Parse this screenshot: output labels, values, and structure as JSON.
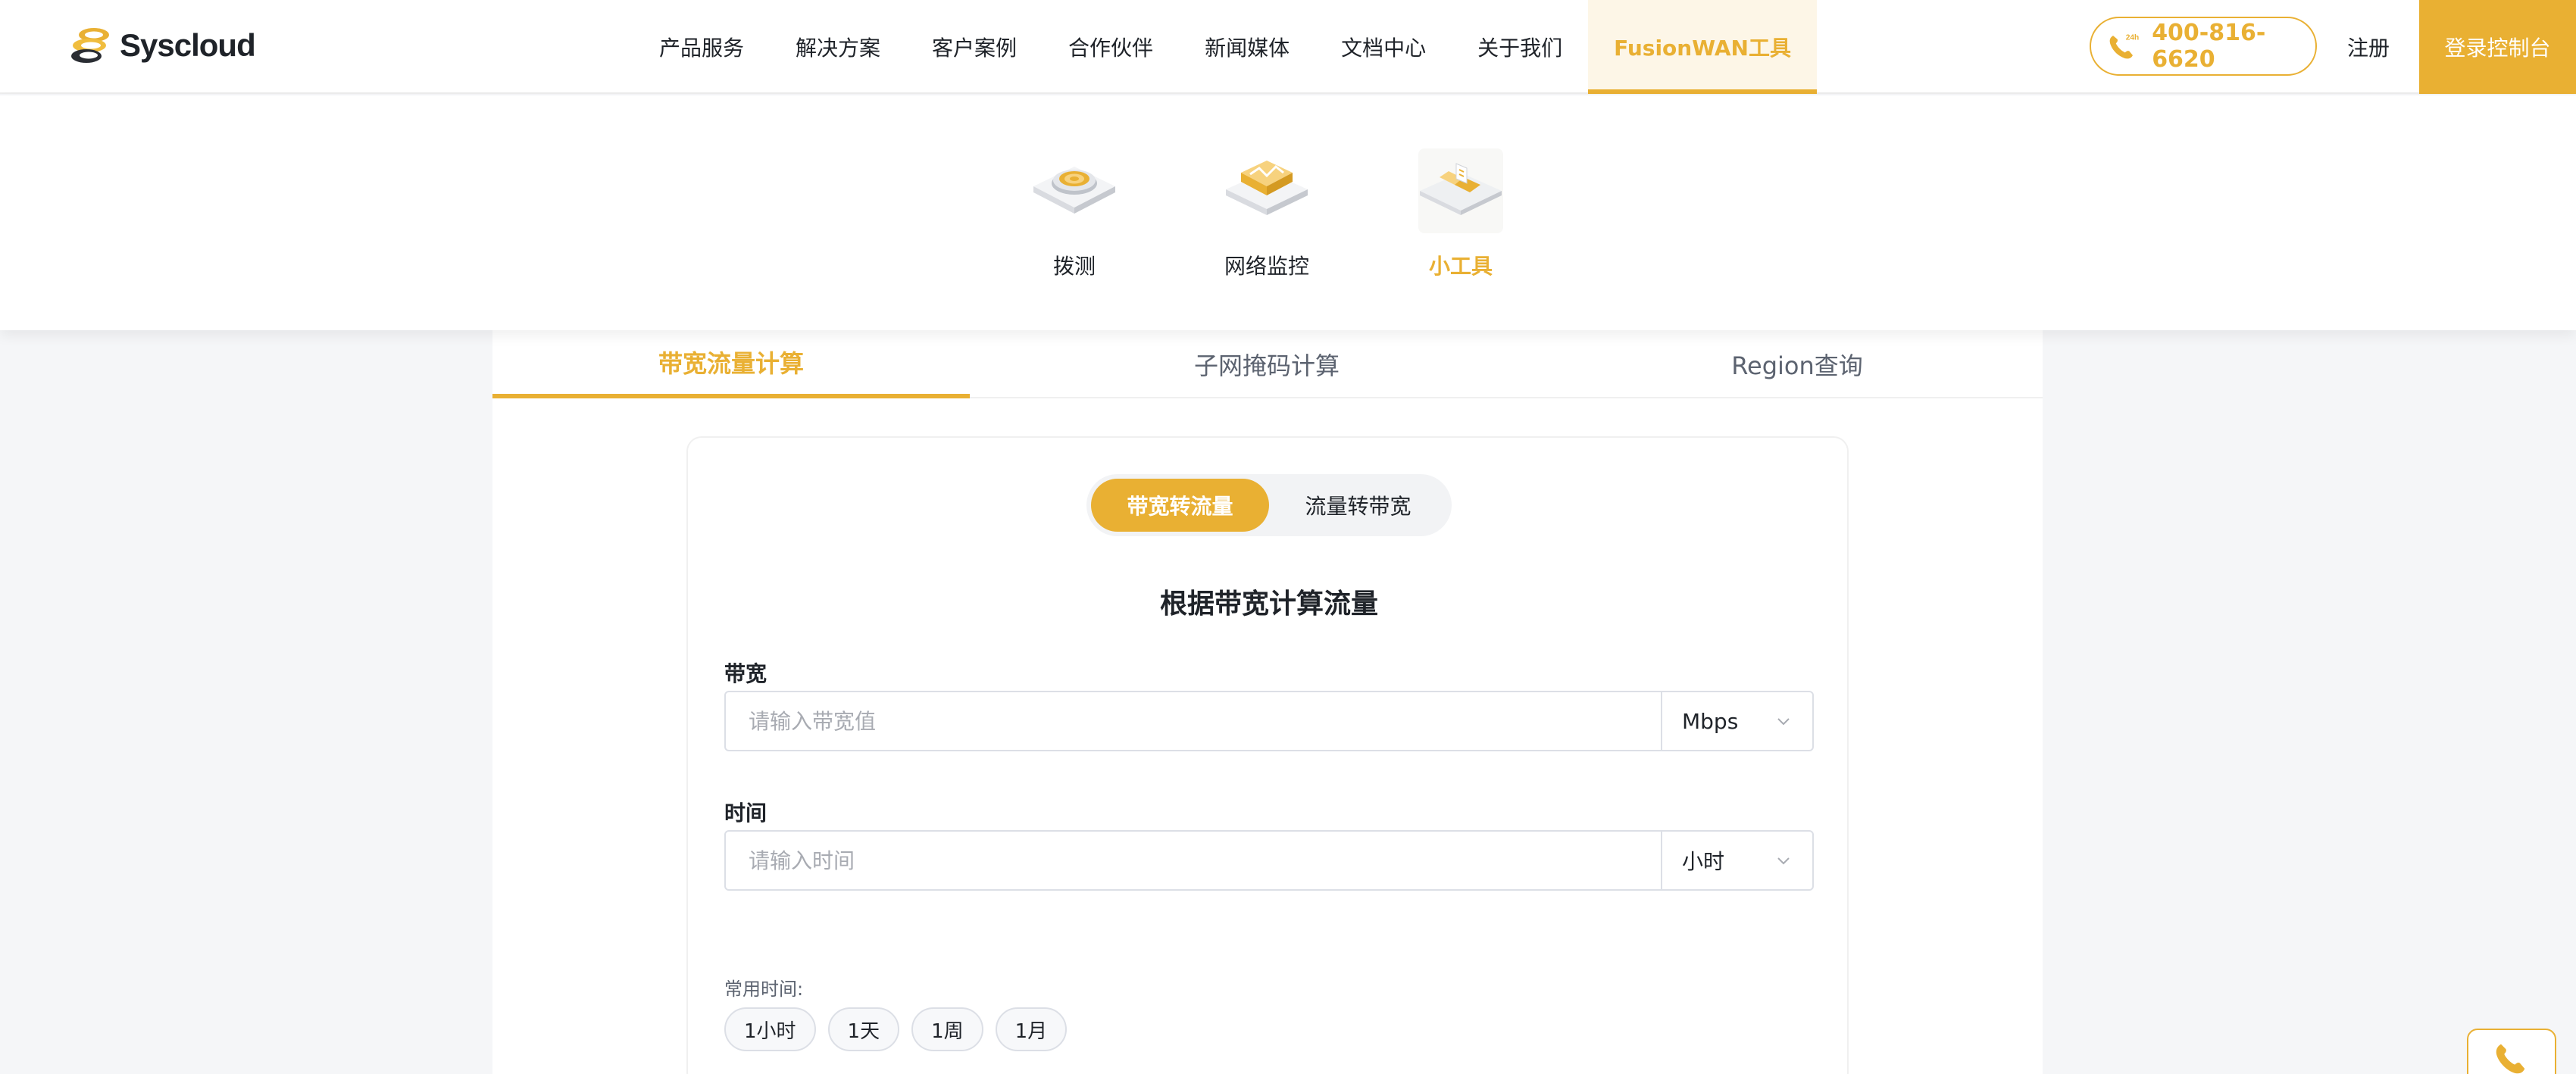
{
  "brand": {
    "name": "Syscloud",
    "accent": "#e9b033"
  },
  "nav": {
    "items": [
      {
        "label": "产品服务"
      },
      {
        "label": "解决方案"
      },
      {
        "label": "客户案例"
      },
      {
        "label": "合作伙伴"
      },
      {
        "label": "新闻媒体"
      },
      {
        "label": "文档中心"
      },
      {
        "label": "关于我们"
      },
      {
        "label": "FusionWAN工具",
        "active": true
      }
    ]
  },
  "header": {
    "phone": "400-816-6620",
    "phone_badge": "24h",
    "register": "注册",
    "console": "登录控制台"
  },
  "dropdown": {
    "items": [
      {
        "label": "拨测",
        "icon": "dial-test-icon"
      },
      {
        "label": "网络监控",
        "icon": "network-monitor-icon"
      },
      {
        "label": "小工具",
        "icon": "tools-icon",
        "active": true
      }
    ]
  },
  "tabs": [
    {
      "label": "带宽流量计算",
      "active": true
    },
    {
      "label": "子网掩码计算"
    },
    {
      "label": "Region查询"
    }
  ],
  "toggle": {
    "options": [
      {
        "label": "带宽转流量",
        "active": true
      },
      {
        "label": "流量转带宽"
      }
    ]
  },
  "form": {
    "title": "根据带宽计算流量",
    "bandwidth": {
      "label": "带宽",
      "placeholder": "请输入带宽值",
      "unit": "Mbps"
    },
    "time": {
      "label": "时间",
      "placeholder": "请输入时间",
      "unit": "小时"
    },
    "common_time_label": "常用时间:",
    "presets": [
      "1小时",
      "1天",
      "1周",
      "1月"
    ]
  }
}
